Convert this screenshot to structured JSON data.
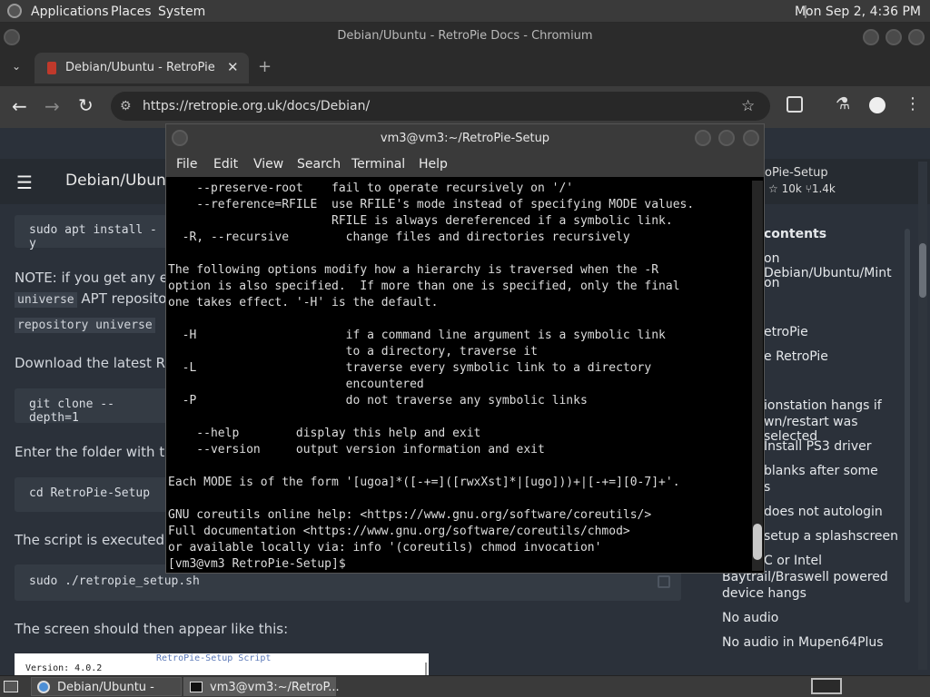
{
  "top_panel": {
    "menus": [
      "Applications",
      "Places",
      "System"
    ],
    "clock": "Mon Sep  2,  4:36 PM"
  },
  "browser": {
    "window_title": "Debian/Ubuntu - RetroPie Docs - Chromium",
    "tab_title": "Debian/Ubuntu - RetroPie Do",
    "url": "https://retropie.org.uk/docs/Debian/"
  },
  "page": {
    "header_title": "Debian/Ubuntu",
    "repo_name": "oPie-Setup",
    "stars": "10k",
    "forks": "1.4k",
    "code1": "sudo apt install -y",
    "note": "NOTE: if you get any err",
    "inline1": "universe",
    "note2": "APT reposito",
    "inline2": "repository universe",
    "download_text": "Download the latest Re",
    "code2": "git clone --depth=1",
    "enter_text": "Enter the folder with th",
    "code3": "cd RetroPie-Setup",
    "script_text": "The script is executed w",
    "code4": "sudo ./retropie_setup.sh",
    "screen_text": "The screen should then appear like this:",
    "preview_title": "RetroPie-Setup Script",
    "preview_version": "Version: 4.0.2",
    "toc": [
      "contents",
      "on Debian/Ubuntu/Mint",
      "on",
      "etroPie",
      "e RetroPie",
      "ionstation hangs if",
      "wn/restart was selected",
      "Install PS3 driver",
      "blanks after some",
      "s",
      "does not autologin",
      "setup a splashscreen",
      "C or Intel",
      "Baytrail/Braswell powered",
      "device hangs",
      "No audio",
      "No audio in Mupen64Plus"
    ]
  },
  "terminal": {
    "title": "vm3@vm3:~/RetroPie-Setup",
    "menu": [
      "File",
      "Edit",
      "View",
      "Search",
      "Terminal",
      "Help"
    ],
    "lines": [
      "    --preserve-root    fail to operate recursively on '/'",
      "    --reference=RFILE  use RFILE's mode instead of specifying MODE values.",
      "                       RFILE is always dereferenced if a symbolic link.",
      "  -R, --recursive        change files and directories recursively",
      "",
      "The following options modify how a hierarchy is traversed when the -R",
      "option is also specified.  If more than one is specified, only the final",
      "one takes effect. '-H' is the default.",
      "",
      "  -H                     if a command line argument is a symbolic link",
      "                         to a directory, traverse it",
      "  -L                     traverse every symbolic link to a directory",
      "                         encountered",
      "  -P                     do not traverse any symbolic links",
      "",
      "    --help        display this help and exit",
      "    --version     output version information and exit",
      "",
      "Each MODE is of the form '[ugoa]*([-+=]([rwxXst]*|[ugo]))+|[-+=][0-7]+'.",
      "",
      "GNU coreutils online help: <https://www.gnu.org/software/coreutils/>",
      "Full documentation <https://www.gnu.org/software/coreutils/chmod>",
      "or available locally via: info '(coreutils) chmod invocation'",
      "[vm3@vm3 RetroPie-Setup]$"
    ]
  },
  "taskbar": {
    "items": [
      "Debian/Ubuntu - Re...",
      "vm3@vm3:~/RetroP..."
    ]
  }
}
